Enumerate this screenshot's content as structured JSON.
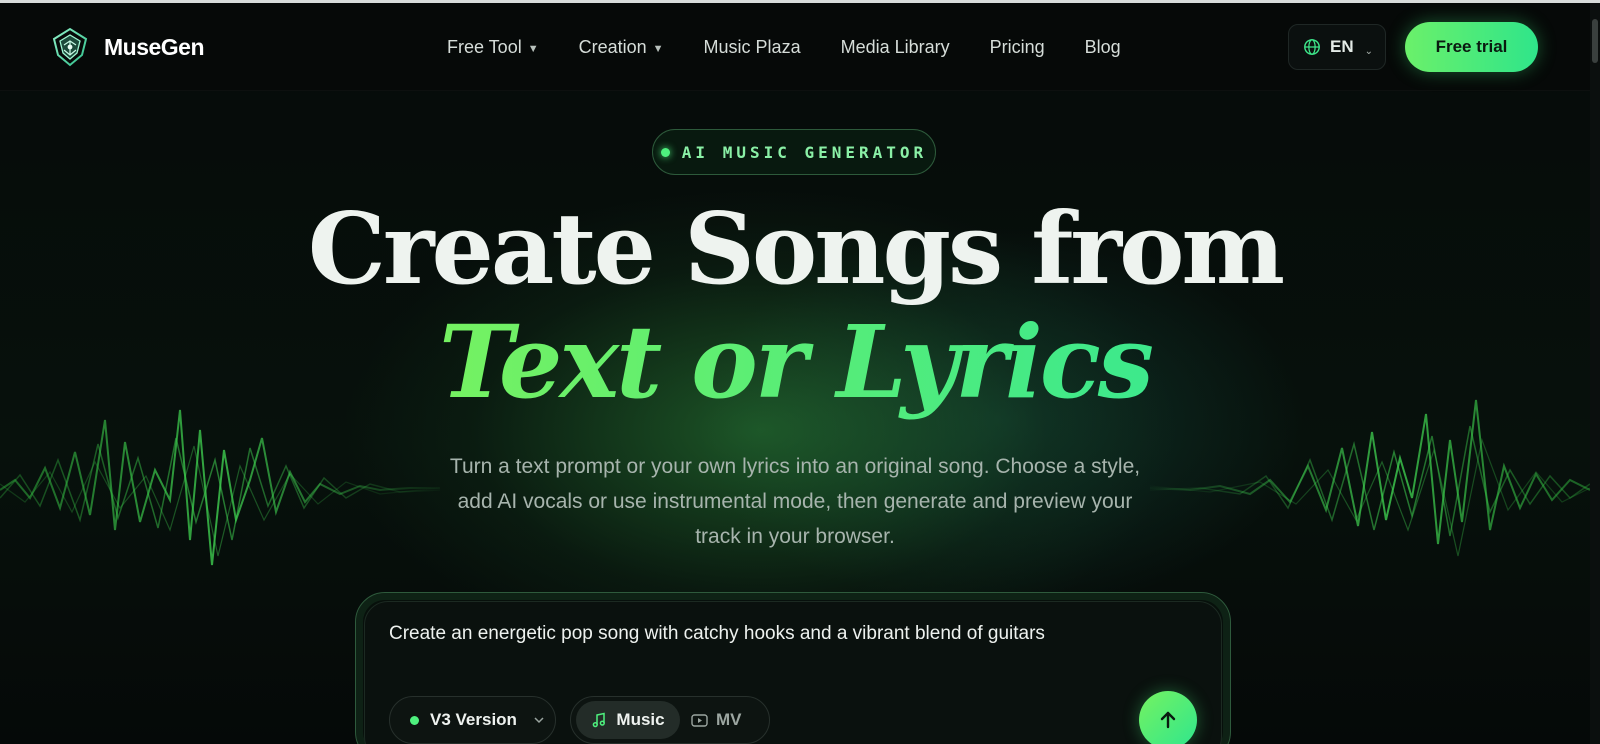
{
  "brand": {
    "name": "MuseGen",
    "logo_icon": "musegen-logo-icon"
  },
  "nav": {
    "items": [
      {
        "label": "Free Tool",
        "has_dropdown": true
      },
      {
        "label": "Creation",
        "has_dropdown": true
      },
      {
        "label": "Music Plaza",
        "has_dropdown": false
      },
      {
        "label": "Media Library",
        "has_dropdown": false
      },
      {
        "label": "Pricing",
        "has_dropdown": false
      },
      {
        "label": "Blog",
        "has_dropdown": false
      }
    ],
    "dropdown_glyph": "▼",
    "language": {
      "code": "EN",
      "icon": "globe-icon",
      "caret": "⌄"
    },
    "cta_label": "Free trial"
  },
  "hero": {
    "badge": "AI MUSIC GENERATOR",
    "title_line1": "Create Songs from",
    "title_line2": "Text or Lyrics",
    "subtitle": "Turn a text prompt or your own lyrics into an original song. Choose a style, add AI vocals or use instrumental mode, then generate and preview your track in your browser."
  },
  "composer": {
    "prompt_value": "Create an energetic pop song with catchy hooks and a vibrant blend of guitars",
    "version_label": "V3 Version",
    "modes": [
      {
        "label": "Music",
        "icon": "music-note-icon",
        "selected": true
      },
      {
        "label": "MV",
        "icon": "video-icon",
        "selected": false
      }
    ],
    "submit_icon": "arrow-up-icon"
  },
  "colors": {
    "accent_green": "#4ef07e",
    "cta_gradient_start": "#6bf06a",
    "cta_gradient_end": "#2fe58a",
    "background": "#050908"
  }
}
